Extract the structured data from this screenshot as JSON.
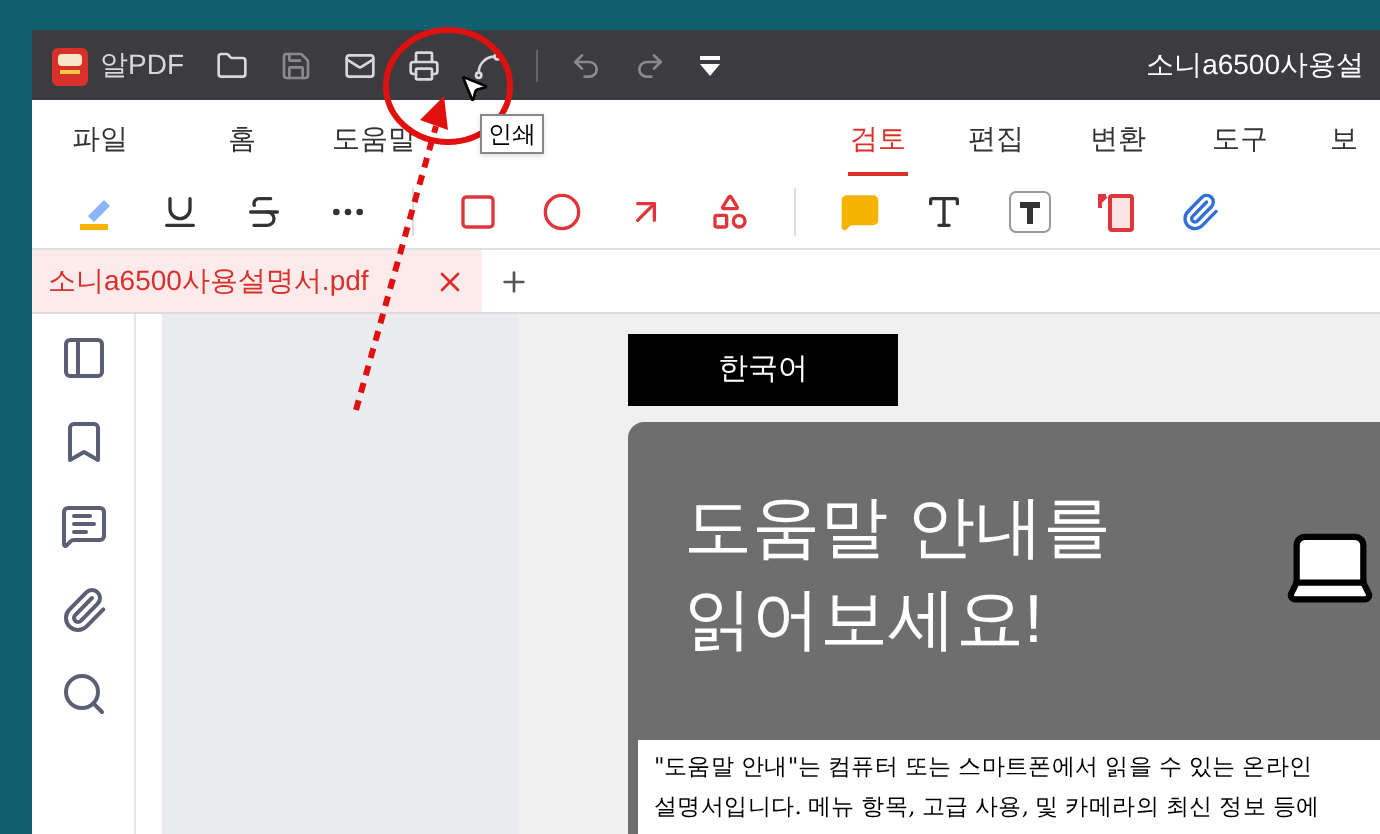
{
  "title_bar": {
    "app_name": "알PDF",
    "document_title": "소니a6500사용설"
  },
  "menu_tabs": [
    {
      "label": "파일",
      "selected": false
    },
    {
      "label": "홈",
      "selected": false
    },
    {
      "label": "도움말",
      "selected": false
    },
    {
      "label": "검토",
      "selected": true
    },
    {
      "label": "편집",
      "selected": false
    },
    {
      "label": "변환",
      "selected": false
    },
    {
      "label": "도구",
      "selected": false
    },
    {
      "label": "보",
      "selected": false
    }
  ],
  "tooltip": "인쇄",
  "document_tabs": [
    {
      "label": "소니a6500사용설명서.pdf",
      "selected": true
    }
  ],
  "page": {
    "language_label": "한국어",
    "heading_lines": [
      "도움말 안내를",
      "읽어보세요!"
    ],
    "paragraph_lines": [
      "\"도움말 안내\"는 컴퓨터 또는 스마트폰에서 읽을 수 있는 온라인",
      "설명서입니다. 메뉴 항목, 고급 사용, 및 카메라의 최신 정보 등에"
    ]
  }
}
